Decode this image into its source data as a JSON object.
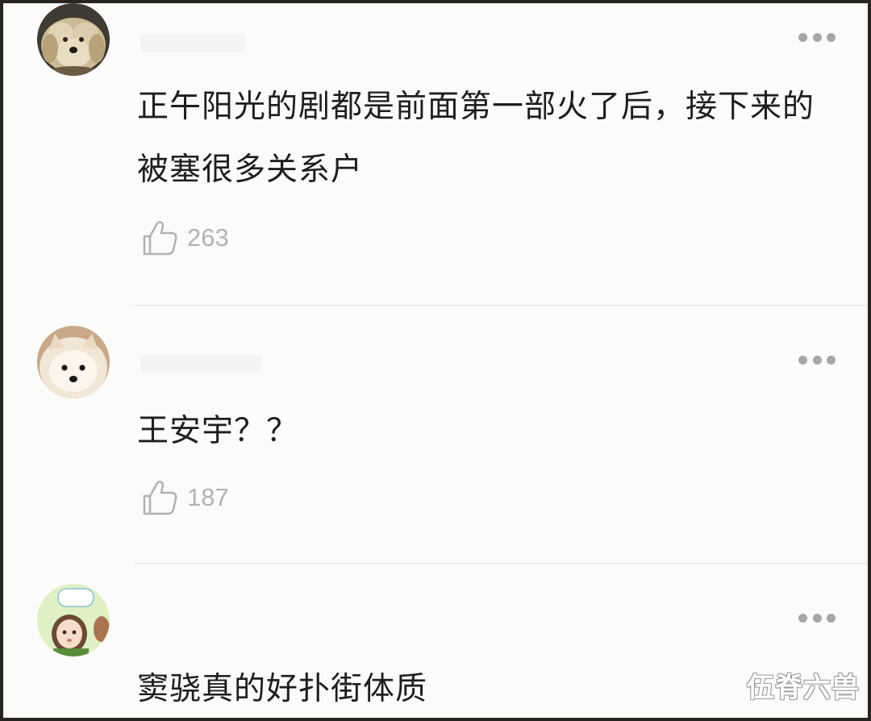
{
  "comments": [
    {
      "avatar_icon": "poodle-dog-avatar",
      "text": "正午阳光的剧都是前面第一部火了后，接下来的被塞很多关系户",
      "likes": "263"
    },
    {
      "avatar_icon": "pomeranian-dog-avatar",
      "text": "王安宇？？",
      "likes": "187"
    },
    {
      "avatar_icon": "cartoon-girl-avatar",
      "text": "窦骁真的好扑街体质",
      "likes": ""
    }
  ],
  "icons": {
    "more": "more-dots-icon",
    "like": "thumbs-up-icon"
  },
  "watermark": "伍脊六兽",
  "colors": {
    "text": "#1e1e1e",
    "like_count": "#b2b2b2",
    "more_dots": "#a6a6a6",
    "divider": "#e3e3dc",
    "frame_border": "#2a2420"
  }
}
